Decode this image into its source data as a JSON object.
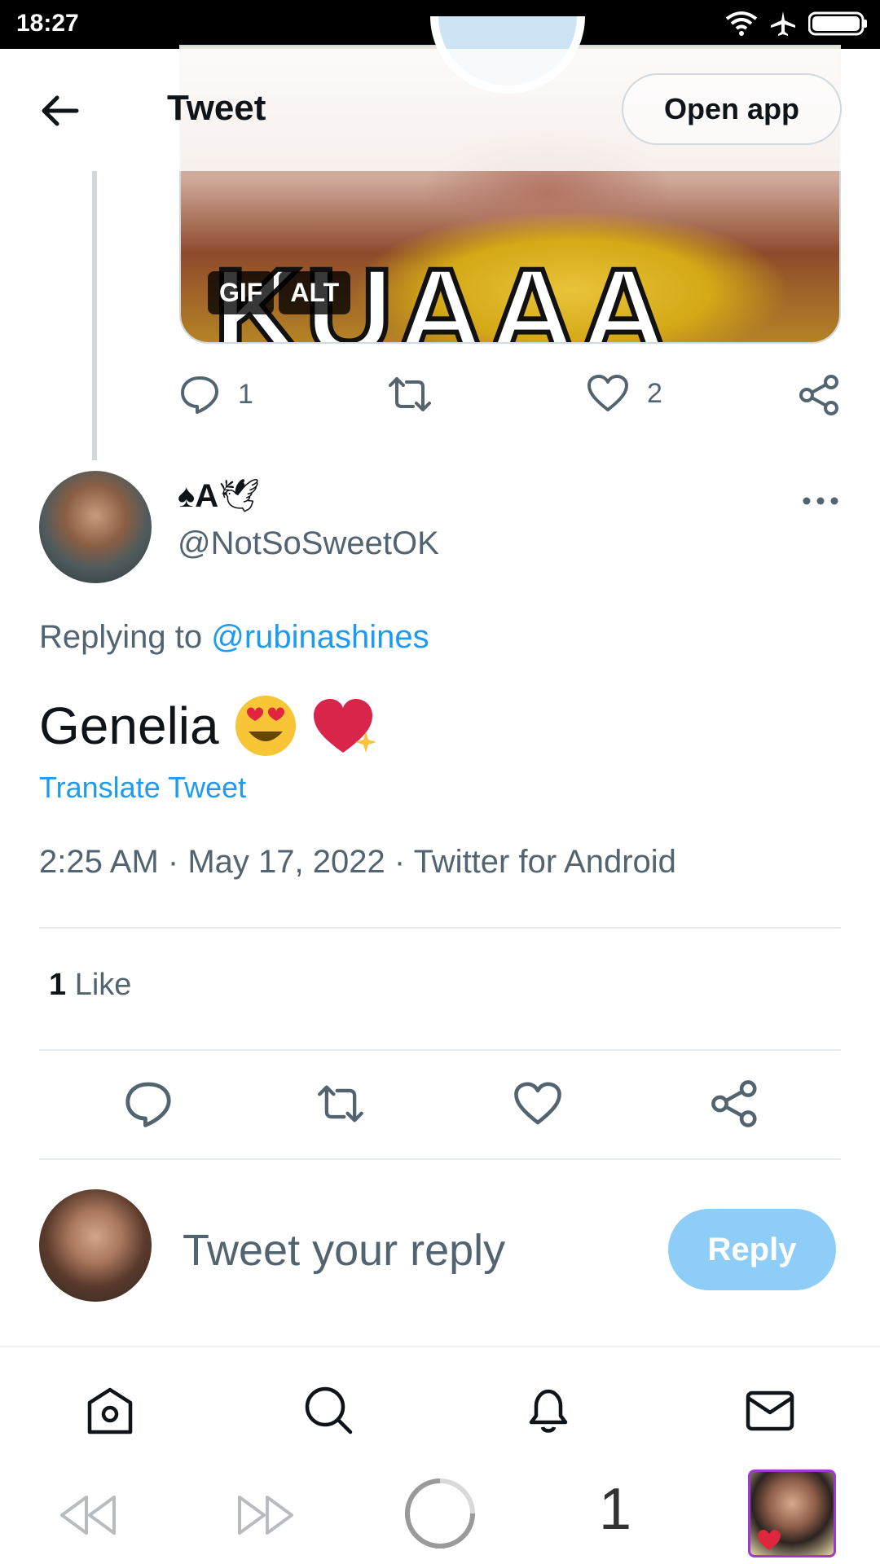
{
  "status_bar": {
    "time": "18:27"
  },
  "header": {
    "title": "Tweet",
    "open_app_label": "Open app"
  },
  "parent_tweet": {
    "gif_badge": "GIF",
    "alt_badge": "ALT",
    "gif_text": "KUAAA",
    "reply_count": "1",
    "like_count": "2"
  },
  "tweet": {
    "author_name": "A",
    "author_handle": "@NotSoSweetOK",
    "replying_prefix": "Replying to",
    "replying_to": "@rubinashines",
    "text": "Genelia",
    "translate_label": "Translate Tweet",
    "time": "2:25 AM",
    "date": "May 17, 2022",
    "source": "Twitter for Android",
    "likes_count": "1",
    "likes_label": "Like"
  },
  "composer": {
    "placeholder": "Tweet your reply",
    "reply_button": "Reply"
  },
  "browser": {
    "tab_count": "1"
  },
  "colors": {
    "accent": "#1d9bf0",
    "reply_button": "#8ecdf8",
    "secondary_text": "#536471"
  }
}
